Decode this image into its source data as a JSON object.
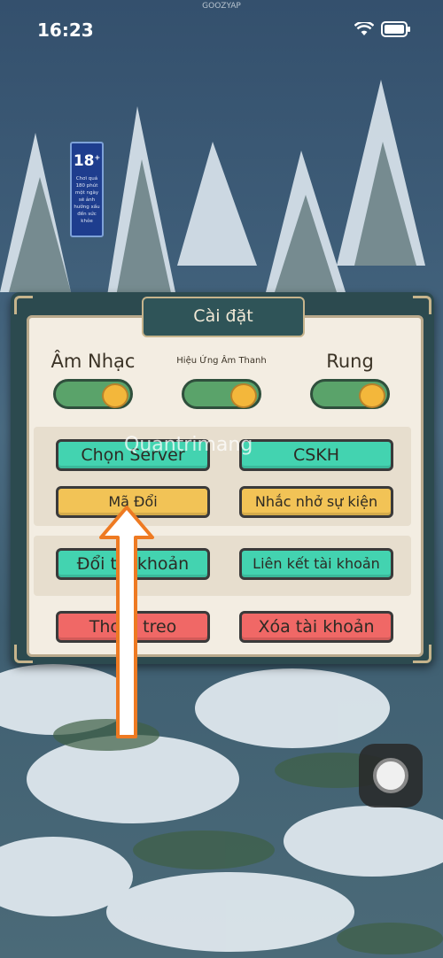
{
  "status_bar": {
    "time": "16:23",
    "notch_text": "GOOZYAP"
  },
  "age_rating": {
    "badge": "18",
    "plus": "+",
    "note": "Chơi quá 180 phút một ngày sẽ ảnh hưởng xấu đến sức khỏe"
  },
  "dialog": {
    "title": "Cài đặt",
    "toggles": [
      {
        "label": "Âm Nhạc",
        "on": true
      },
      {
        "label": "Hiệu Ứng Âm Thanh",
        "on": true
      },
      {
        "label": "Rung",
        "on": true
      }
    ],
    "buttons": {
      "choose_server": "Chọn Server",
      "cskh": "CSKH",
      "redeem_code": "Mã Đổi",
      "event_reminder": "Nhắc nhở sự kiện",
      "switch_account": "Đổi tài khoản",
      "link_account": "Liên kết tài khoản",
      "quit_idle": "Thoát treo",
      "delete_account": "Xóa tài khoản"
    },
    "colors": {
      "teal": "#43d3b0",
      "yellow": "#f2c356",
      "red": "#f06866",
      "toggle_on": "#5aa36a"
    }
  },
  "watermark": "Quantrimang",
  "annotation": {
    "arrow_color": "#ee7a22"
  }
}
